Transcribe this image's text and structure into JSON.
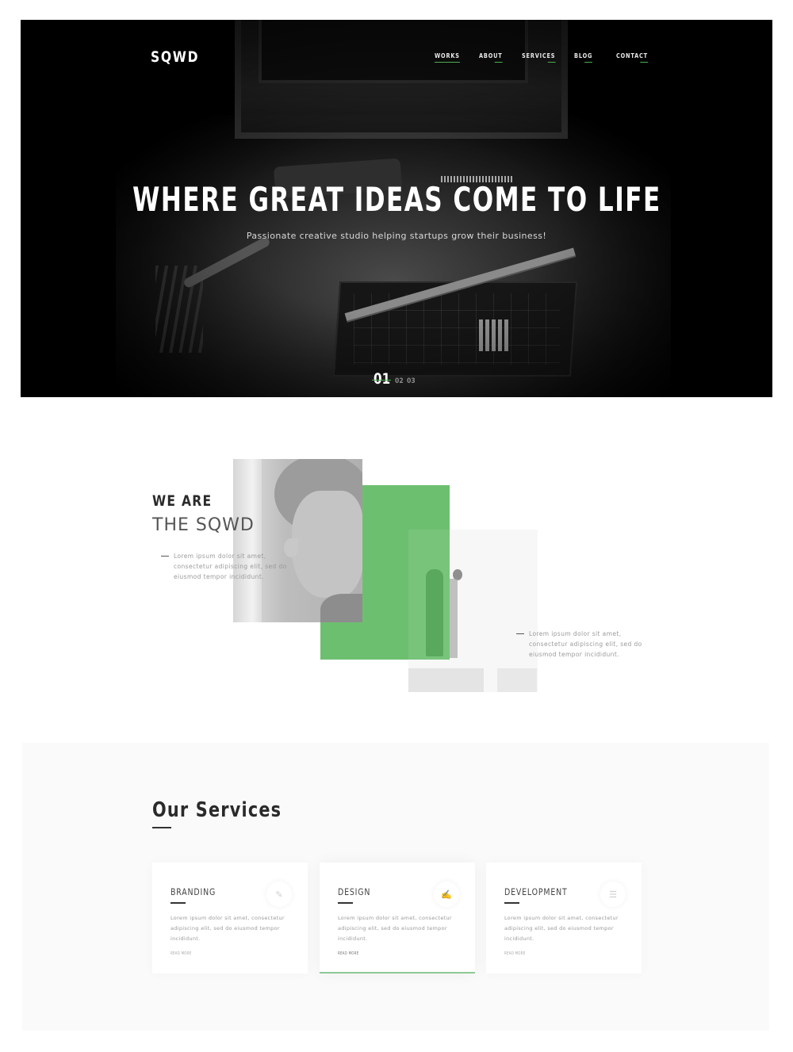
{
  "header": {
    "logo": "SQWD",
    "nav": [
      {
        "label": "WORKS",
        "active": true
      },
      {
        "label": "ABOUT",
        "active": false
      },
      {
        "label": "SERVICES",
        "active": false
      },
      {
        "label": "BLOG",
        "active": false
      },
      {
        "label": "CONTACT",
        "active": false
      }
    ]
  },
  "hero": {
    "title": "WHERE GREAT IDEAS COME TO LIFE",
    "subtitle": "Passionate creative studio helping startups grow their business!",
    "slides": {
      "active": "01",
      "others": [
        "02",
        "03"
      ]
    }
  },
  "about": {
    "title_line1": "WE ARE",
    "title_line2": "THE SQWD",
    "text1": "Lorem ipsum dolor sit amet, consectetur adipiscing elit, sed do eiusmod tempor incididunt.",
    "text2": "Lorem ipsum dolor sit amet, consectetur adipiscing elit, sed do eiusmod tempor incididunt."
  },
  "services": {
    "title": "Our Services",
    "cards": [
      {
        "title": "BRANDING",
        "text": "Lorem ipsum dolor sit amet, consectetur adipiscing elit, sed do eiusmod tempor incididunt.",
        "link": "READ MORE",
        "icon": "branding-icon",
        "glyph": "✎"
      },
      {
        "title": "DESIGN",
        "text": "Lorem ipsum dolor sit amet, consectetur adipiscing elit, sed do eiusmod tempor incididunt.",
        "link": "READ MORE",
        "icon": "design-icon",
        "glyph": "✍"
      },
      {
        "title": "DEVELOPMENT",
        "text": "Lorem ipsum dolor sit amet, consectetur adipiscing elit, sed do eiusmod tempor incididunt.",
        "link": "READ MORE",
        "icon": "development-icon",
        "glyph": "☰"
      }
    ]
  },
  "colors": {
    "accent": "#6dbf70",
    "hero_bg": "#000000",
    "services_bg": "#fafafa"
  }
}
